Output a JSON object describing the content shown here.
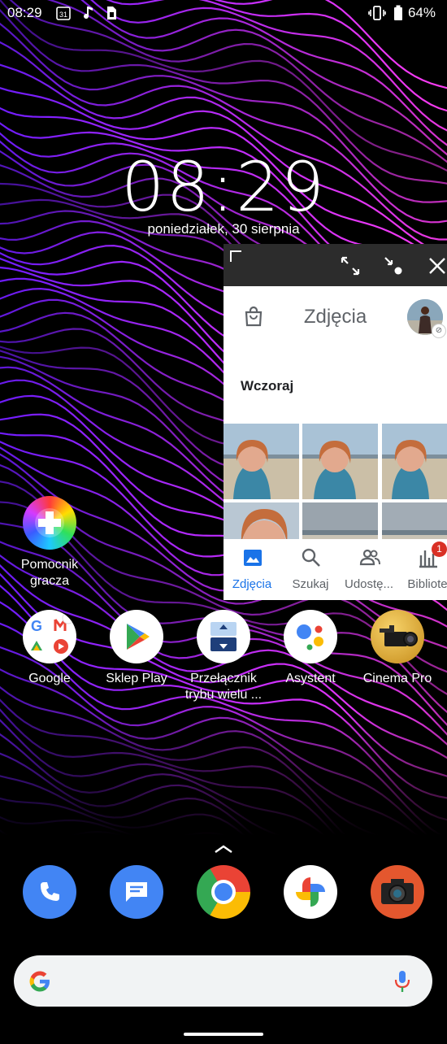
{
  "status_bar": {
    "time": "08:29",
    "calendar_day": "31",
    "battery_percent": "64%"
  },
  "lock_clock": {
    "time": "08:29",
    "date": "poniedziałek, 30 sierpnia"
  },
  "floating_window": {
    "app_title": "Zdjęcia",
    "section_label": "Wczoraj",
    "nav": [
      {
        "label": "Zdjęcia",
        "icon": "photo-icon",
        "active": true
      },
      {
        "label": "Szukaj",
        "icon": "search-icon",
        "active": false
      },
      {
        "label": "Udostę...",
        "icon": "people-icon",
        "active": false
      },
      {
        "label": "Bibliote",
        "icon": "library-icon",
        "active": false,
        "badge": "1"
      }
    ]
  },
  "home_apps": [
    {
      "label": "Pomocnik gracza",
      "line1": "Pomocnik",
      "line2": "gracza",
      "icon": "game-enhancer-icon"
    },
    {
      "label": "Google",
      "icon": "google-folder-icon"
    },
    {
      "label": "Sklep Play",
      "icon": "play-store-icon"
    },
    {
      "label": "Przełącznik trybu wielu ...",
      "line1": "Przełącznik",
      "line2": "trybu wielu ...",
      "icon": "multi-window-icon"
    },
    {
      "label": "Asystent",
      "icon": "assistant-icon"
    },
    {
      "label": "Cinema Pro",
      "icon": "cinema-pro-icon"
    }
  ],
  "dock": [
    {
      "icon": "phone-icon"
    },
    {
      "icon": "messages-icon"
    },
    {
      "icon": "chrome-icon"
    },
    {
      "icon": "photos-icon"
    },
    {
      "icon": "camera-icon"
    }
  ],
  "colors": {
    "google_blue": "#4285F4",
    "google_red": "#EA4335",
    "google_yellow": "#FBBC05",
    "google_green": "#34A853",
    "photos_accent": "#1a73e8"
  }
}
